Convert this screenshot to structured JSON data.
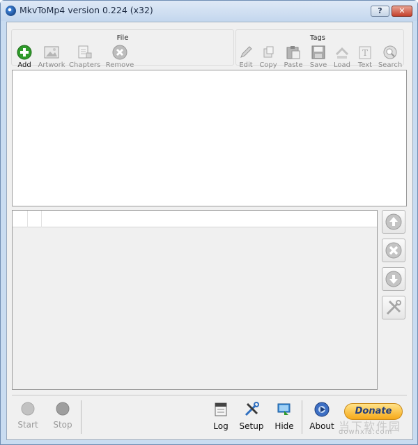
{
  "window": {
    "title": "MkvToMp4 version 0.224 (x32)",
    "help_label": "?",
    "close_label": "✕"
  },
  "file_group": {
    "title": "File",
    "tools": [
      {
        "label": "Add",
        "icon": "add-icon",
        "enabled": true
      },
      {
        "label": "Artwork",
        "icon": "artwork-icon",
        "enabled": false
      },
      {
        "label": "Chapters",
        "icon": "chapters-icon",
        "enabled": false
      },
      {
        "label": "Remove",
        "icon": "remove-icon",
        "enabled": false
      }
    ]
  },
  "tags_group": {
    "title": "Tags",
    "tools": [
      {
        "label": "Edit",
        "icon": "pencil-icon"
      },
      {
        "label": "Copy",
        "icon": "copy-icon"
      },
      {
        "label": "Paste",
        "icon": "paste-icon"
      },
      {
        "label": "Save",
        "icon": "save-icon"
      },
      {
        "label": "Load",
        "icon": "load-icon"
      },
      {
        "label": "Text",
        "icon": "text-icon"
      },
      {
        "label": "Search",
        "icon": "search-icon"
      }
    ]
  },
  "side_buttons": [
    {
      "icon": "arrow-up-icon"
    },
    {
      "icon": "delete-icon"
    },
    {
      "icon": "arrow-down-icon"
    },
    {
      "icon": "tools-icon"
    }
  ],
  "bottom": {
    "start_label": "Start",
    "stop_label": "Stop",
    "log_label": "Log",
    "setup_label": "Setup",
    "hide_label": "Hide",
    "about_label": "About",
    "donate_label": "Donate"
  },
  "watermark": {
    "text": "downxia.com",
    "cn": "当下软件园"
  },
  "colors": {
    "accent": "#2f9a2a",
    "donate": "#f6a919",
    "disabled": "#8c8c8c"
  }
}
